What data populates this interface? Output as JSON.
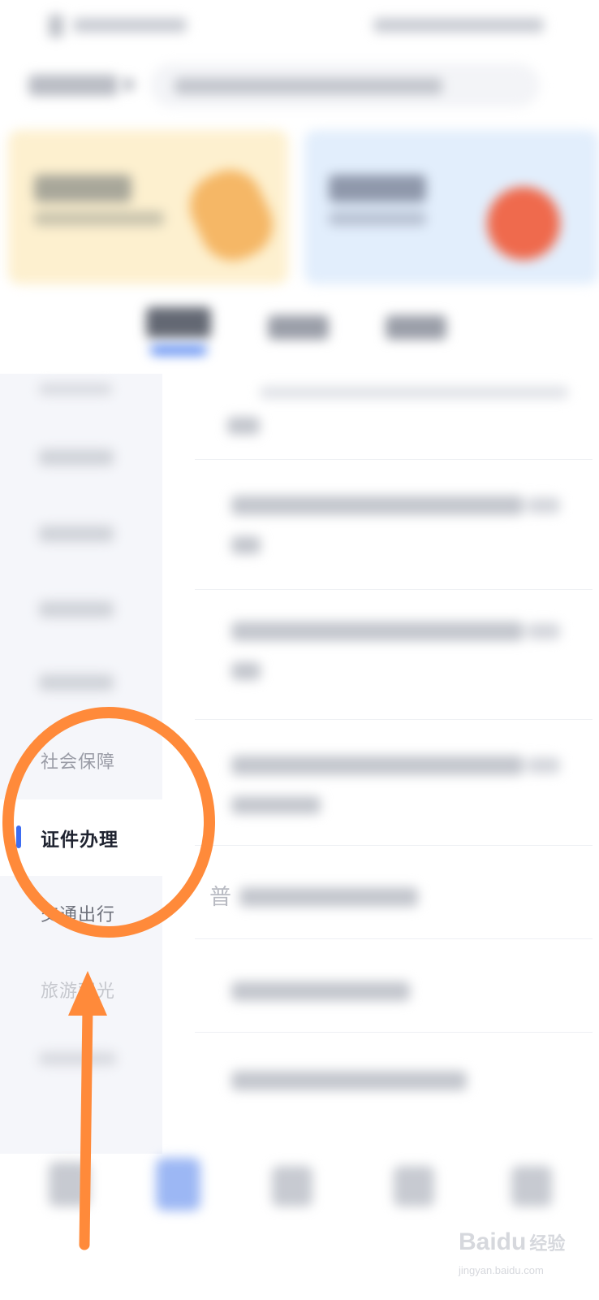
{
  "sidebar": {
    "items": [
      {
        "label": "社会保障",
        "active": false
      },
      {
        "label": "证件办理",
        "active": true
      },
      {
        "label": "交通出行",
        "active": false
      },
      {
        "label": "旅游观光",
        "active": false
      }
    ]
  },
  "content": {
    "partial_text": "普"
  },
  "annotation": {
    "color": "#ff8a3a",
    "shapes": [
      "circle",
      "arrow"
    ]
  },
  "watermark": {
    "brand": "Baidu",
    "text": "经验",
    "subtext": "jingyan.baidu.com"
  },
  "colors": {
    "accent": "#3d6df2",
    "sidebar_bg": "#f5f6fa",
    "annotation": "#ff8a3a"
  }
}
